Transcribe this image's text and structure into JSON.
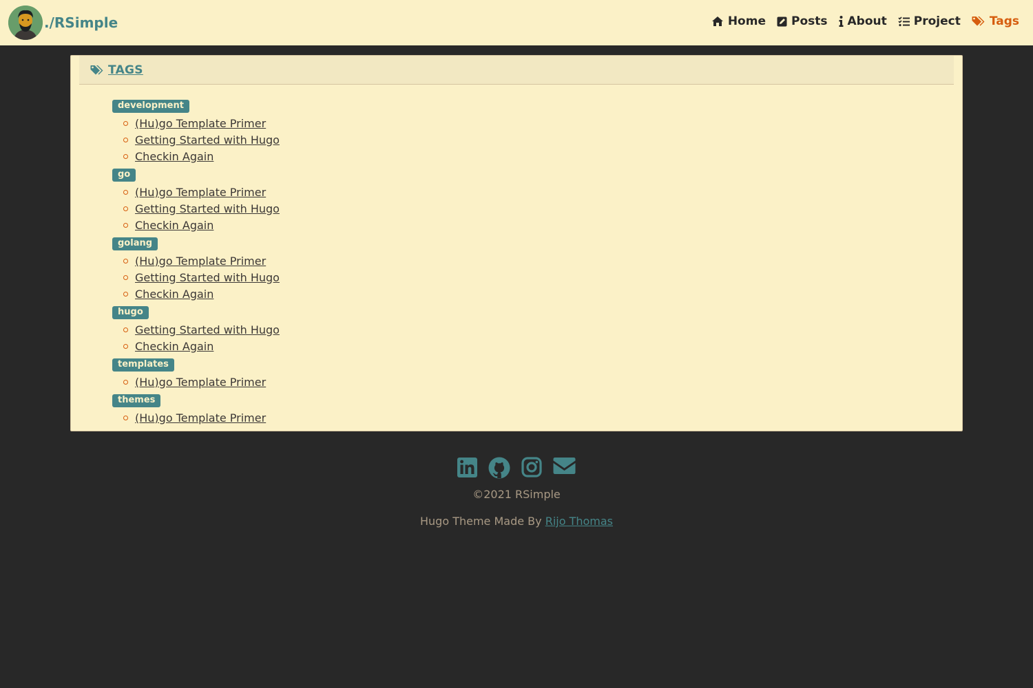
{
  "site": {
    "brand": "./RSimple"
  },
  "nav": {
    "items": [
      {
        "label": "Home",
        "icon": "home-icon"
      },
      {
        "label": "Posts",
        "icon": "edit-icon"
      },
      {
        "label": "About",
        "icon": "info-icon"
      },
      {
        "label": "Project",
        "icon": "tasks-icon"
      },
      {
        "label": "Tags",
        "icon": "tags-icon",
        "active": true
      }
    ]
  },
  "page": {
    "title": "TAGS"
  },
  "tags": [
    {
      "name": "development",
      "posts": [
        "(Hu)go Template Primer",
        "Getting Started with Hugo",
        "Checkin Again"
      ]
    },
    {
      "name": "go",
      "posts": [
        "(Hu)go Template Primer",
        "Getting Started with Hugo",
        "Checkin Again"
      ]
    },
    {
      "name": "golang",
      "posts": [
        "(Hu)go Template Primer",
        "Getting Started with Hugo",
        "Checkin Again"
      ]
    },
    {
      "name": "hugo",
      "posts": [
        "Getting Started with Hugo",
        "Checkin Again"
      ]
    },
    {
      "name": "templates",
      "posts": [
        "(Hu)go Template Primer"
      ]
    },
    {
      "name": "themes",
      "posts": [
        "(Hu)go Template Primer"
      ]
    }
  ],
  "footer": {
    "socials": [
      "linkedin-icon",
      "github-icon",
      "instagram-icon",
      "envelope-icon"
    ],
    "copyright": "©2021 RSimple",
    "credit_prefix": "Hugo Theme Made By",
    "credit_author": "Rijo Thomas"
  },
  "colors": {
    "background": "#282828",
    "surface": "#fbf1c7",
    "accent": "#458588",
    "active": "#d65d0e",
    "muted": "#a89984"
  }
}
